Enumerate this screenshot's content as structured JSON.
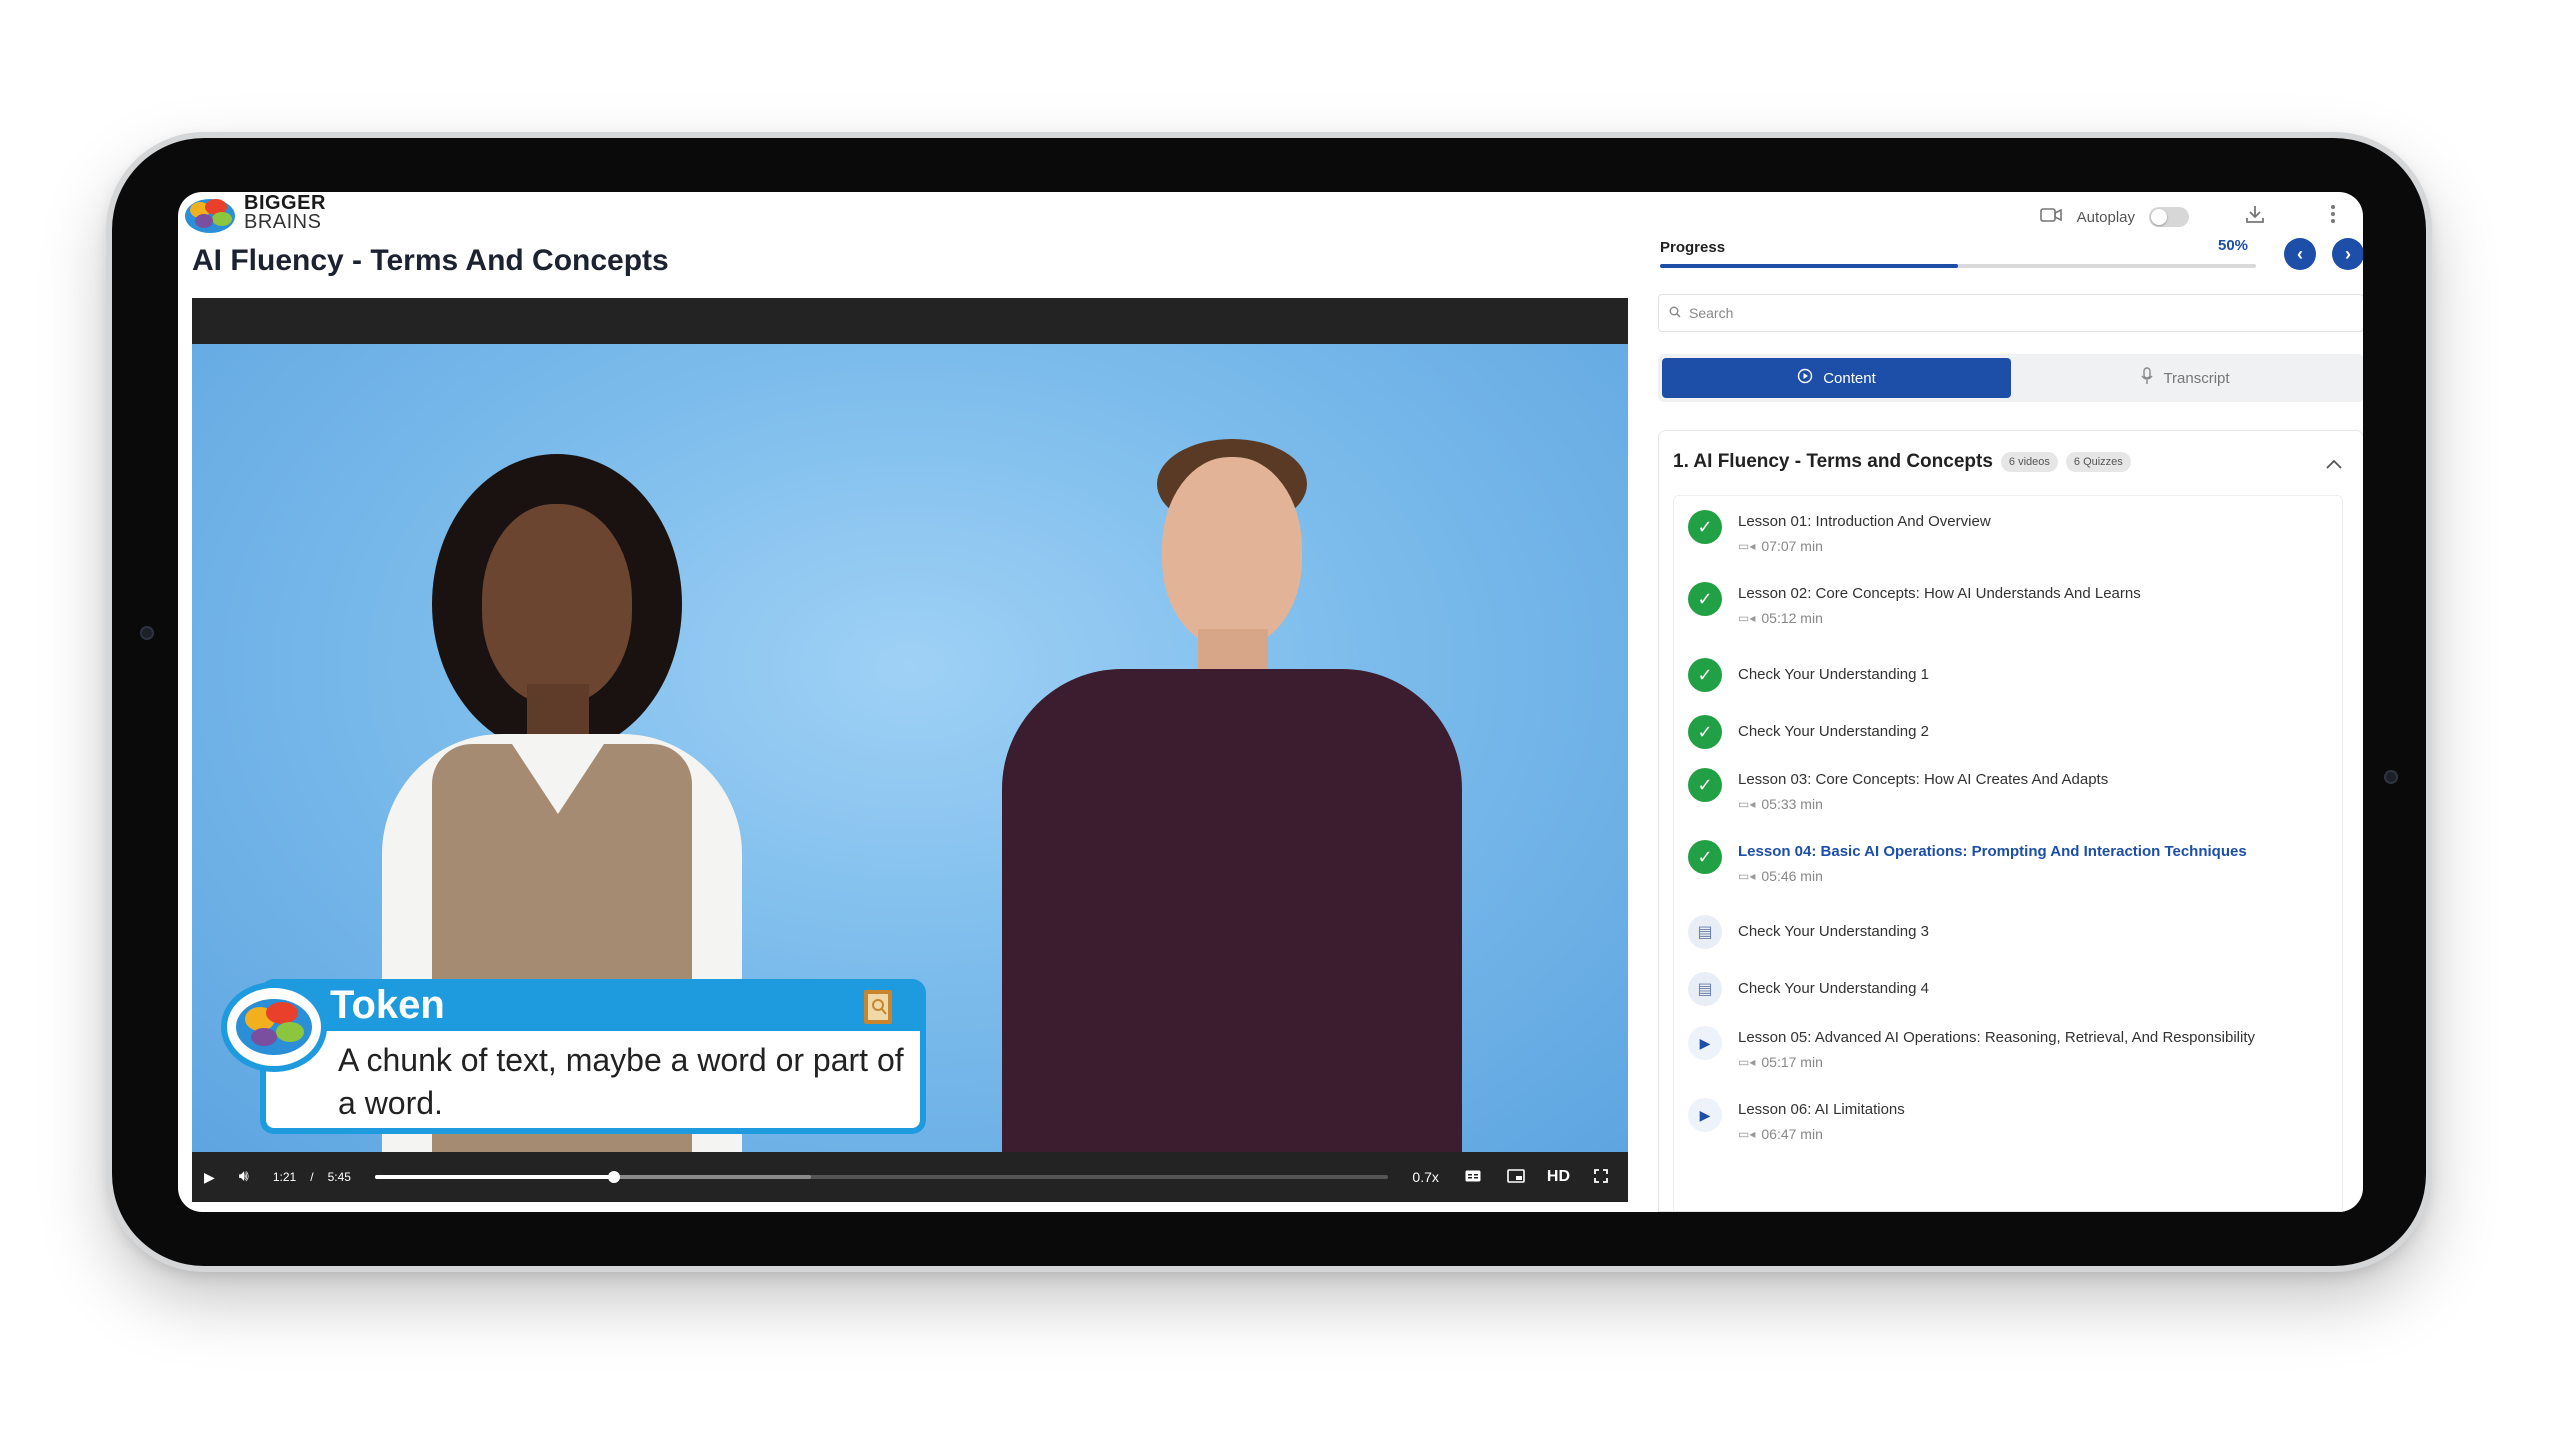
{
  "brand": {
    "line1": "BIGGER",
    "line2": "BRAINS"
  },
  "page_title": "AI Fluency - Terms And Concepts",
  "top_bar": {
    "autoplay_label": "Autoplay",
    "autoplay_on": false
  },
  "video": {
    "caption_title": "Token",
    "caption_text": "A chunk of text, maybe a word or part of a word.",
    "current_time": "1:21",
    "separator": "/",
    "duration": "5:45",
    "played_fraction": 0.236,
    "speed": "0.7x",
    "quality": "HD"
  },
  "progress": {
    "label": "Progress",
    "percent_text": "50%",
    "fraction": 0.5
  },
  "search": {
    "placeholder": "Search"
  },
  "tabs": [
    {
      "label": "Content",
      "active": true
    },
    {
      "label": "Transcript",
      "active": false
    }
  ],
  "section": {
    "title": "1. AI Fluency - Terms and Concepts",
    "videos_badge": "6 videos",
    "quizzes_badge": "6 Quizzes"
  },
  "items": [
    {
      "title": "Lesson 01: Introduction And Overview",
      "duration": "07:07 min",
      "status": "done"
    },
    {
      "title": "Lesson 02: Core Concepts: How AI Understands And Learns",
      "duration": "05:12 min",
      "status": "done"
    },
    {
      "title": "Check Your Understanding 1",
      "duration": "",
      "status": "done"
    },
    {
      "title": "Check Your Understanding 2",
      "duration": "",
      "status": "done"
    },
    {
      "title": "Lesson 03: Core Concepts: How AI Creates And Adapts",
      "duration": "05:33 min",
      "status": "done"
    },
    {
      "title": "Lesson 04: Basic AI Operations: Prompting And Interaction Techniques",
      "duration": "05:46 min",
      "status": "done",
      "current": true
    },
    {
      "title": "Check Your Understanding 3",
      "duration": "",
      "status": "quiz"
    },
    {
      "title": "Check Your Understanding 4",
      "duration": "",
      "status": "quiz"
    },
    {
      "title": "Lesson 05: Advanced AI Operations: Reasoning, Retrieval, And Responsibility",
      "duration": "05:17 min",
      "status": "play"
    },
    {
      "title": "Lesson 06: AI Limitations",
      "duration": "06:47 min",
      "status": "play"
    }
  ],
  "colors": {
    "accent": "#1d4fa8",
    "success": "#22a045",
    "caption_blue": "#1e9ade"
  }
}
